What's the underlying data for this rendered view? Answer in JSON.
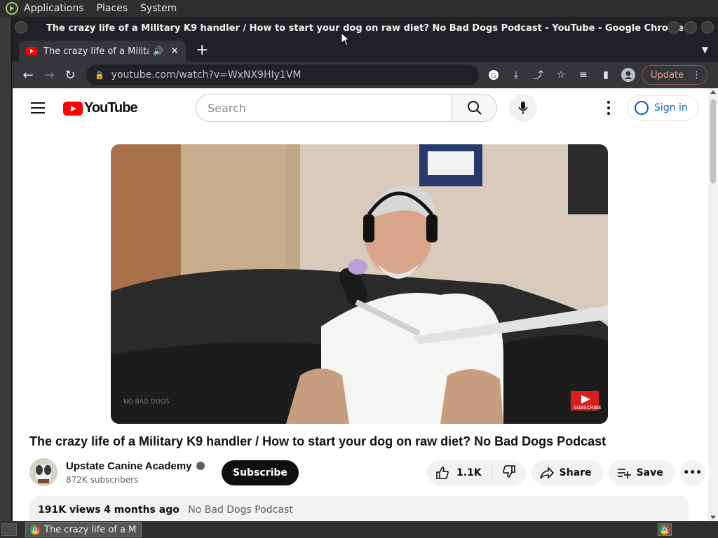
{
  "desktop": {
    "menus": [
      "Applications",
      "Places",
      "System"
    ]
  },
  "window": {
    "title": "The crazy life of a Military K9 handler / How to start your dog on raw diet? No Bad Dogs Podcast - YouTube - Google Chrome"
  },
  "tab": {
    "title": "The crazy life of a Military K",
    "audio_icon": "speaker-icon",
    "close_icon": "close-icon"
  },
  "toolbar": {
    "url": "youtube.com/watch?v=WxNX9HIy1VM",
    "update_label": "Update"
  },
  "youtube": {
    "logo_text": "YouTube",
    "search_placeholder": "Search",
    "signin_label": "Sign in",
    "brand_color": "#ff0000",
    "link_color": "#065fd4"
  },
  "video": {
    "title": "The crazy life of a Military K9 handler / How to start your dog on raw diet? No Bad Dogs Podcast",
    "watermark": "SUBSCRIBE",
    "corner_logo": "NO BAD DOGS"
  },
  "channel": {
    "name": "Upstate Canine Academy",
    "subscribers": "872K subscribers",
    "subscribe_label": "Subscribe"
  },
  "actions": {
    "likes": "1.1K",
    "share_label": "Share",
    "save_label": "Save"
  },
  "description": {
    "views": "191K views",
    "age": "4 months ago",
    "tag": "No Bad Dogs Podcast"
  },
  "taskbar": {
    "item_label": "The crazy life of a Mi..."
  }
}
